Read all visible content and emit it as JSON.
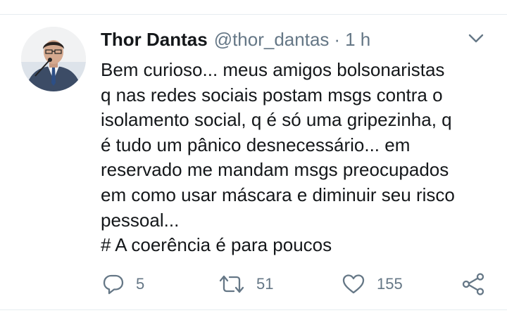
{
  "tweet": {
    "author_name": "Thor Dantas",
    "handle": "@thor_dantas",
    "separator": "·",
    "time": "1 h",
    "lines": [
      "Bem curioso... meus amigos bolsonaristas",
      "q nas redes sociais postam msgs contra o",
      "isolamento social, q é só uma gripezinha, q",
      "é tudo um pânico desnecessário... em",
      "reservado me mandam msgs preocupados",
      "em como usar máscara e diminuir seu risco",
      "pessoal...",
      "# A coerência é para poucos"
    ]
  },
  "actions": {
    "reply": {
      "icon": "reply-icon",
      "count": "5"
    },
    "retweet": {
      "icon": "retweet-icon",
      "count": "51"
    },
    "like": {
      "icon": "heart-icon",
      "count": "155"
    },
    "share": {
      "icon": "share-icon"
    }
  },
  "colors": {
    "text": "#14171a",
    "secondary": "#657786",
    "divider": "#e6ecf0",
    "background": "#ffffff"
  }
}
